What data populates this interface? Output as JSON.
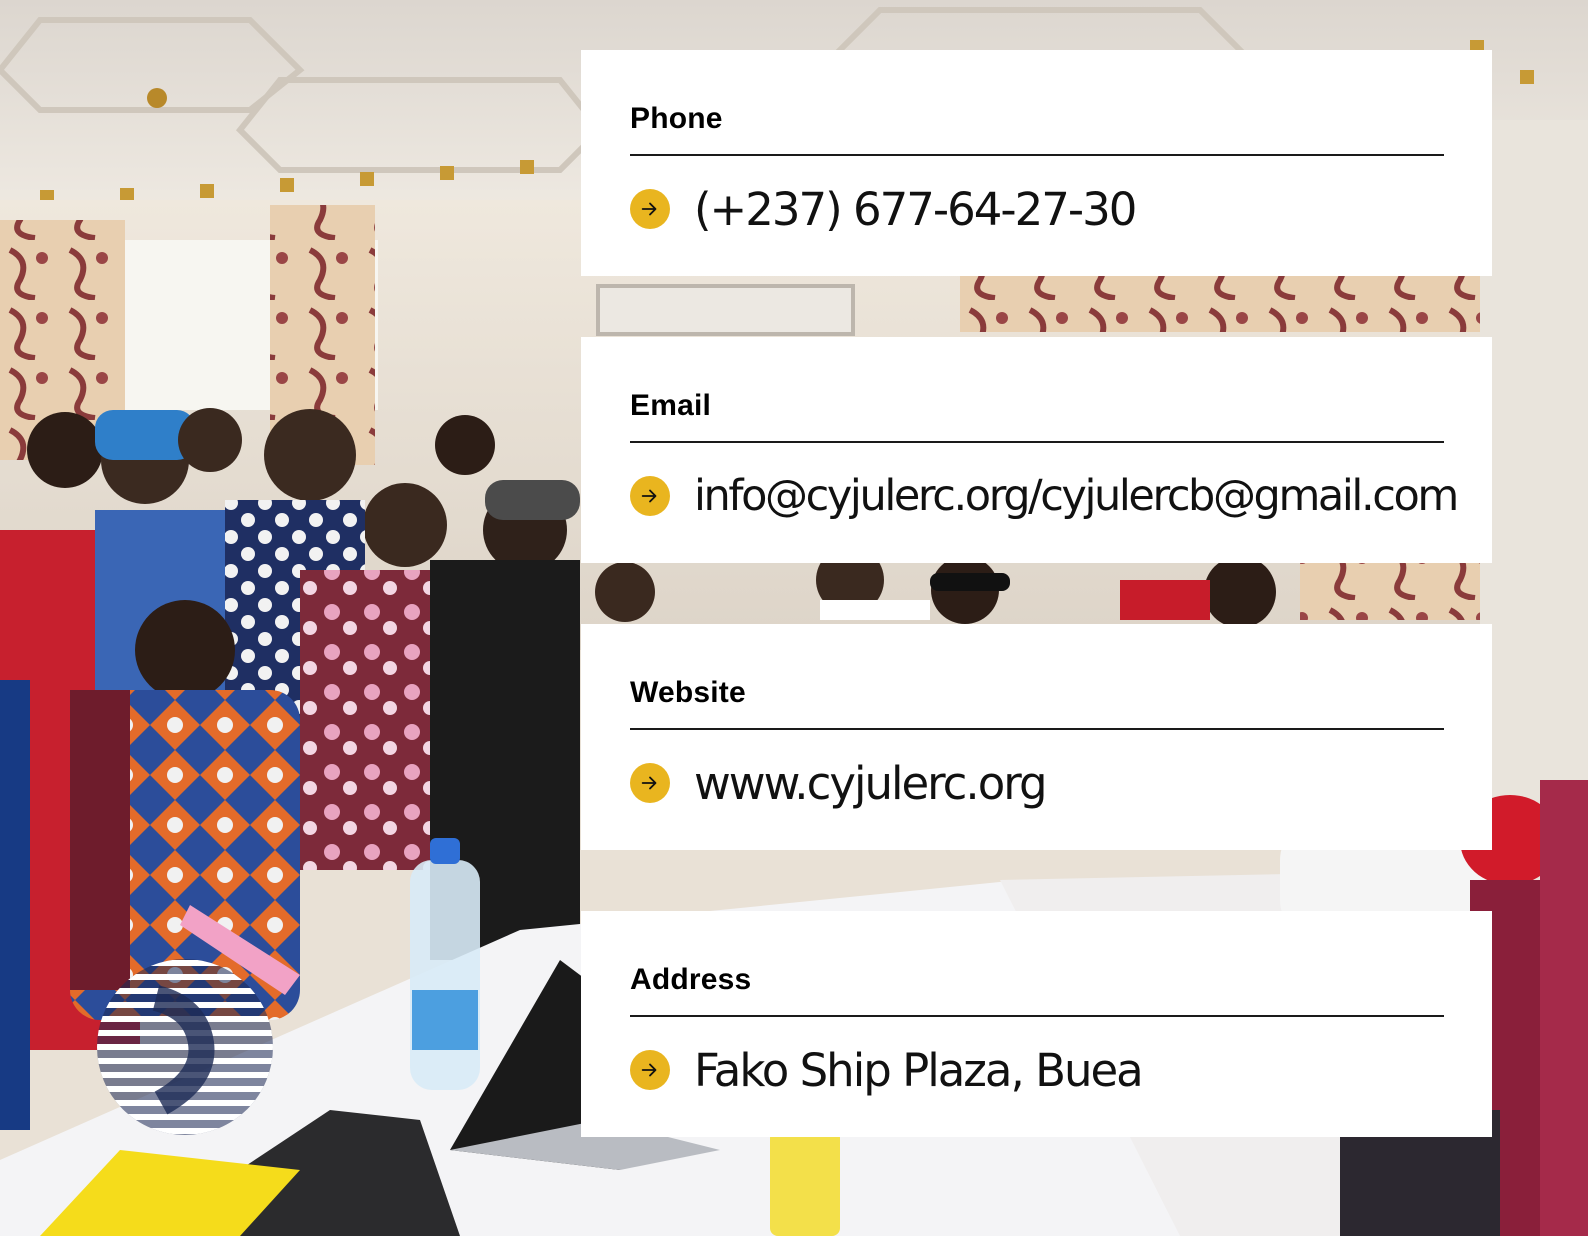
{
  "contacts": [
    {
      "label": "Phone",
      "value": "(+237) 677-64-27-30",
      "icon": "arrow-right-icon"
    },
    {
      "label": "Email",
      "value": "info@cyjulerc.org/cyjulercb@gmail.com",
      "icon": "arrow-right-icon"
    },
    {
      "label": "Website",
      "value": "www.cyjulerc.org",
      "icon": "arrow-right-icon"
    },
    {
      "label": "Address",
      "value": "Fako Ship Plaza, Buea",
      "icon": "arrow-right-icon"
    }
  ],
  "colors": {
    "accent": "#e9b51f",
    "card_background": "#ffffff",
    "text": "#111111"
  },
  "logo": {
    "icon": "striped-circle-logo"
  }
}
